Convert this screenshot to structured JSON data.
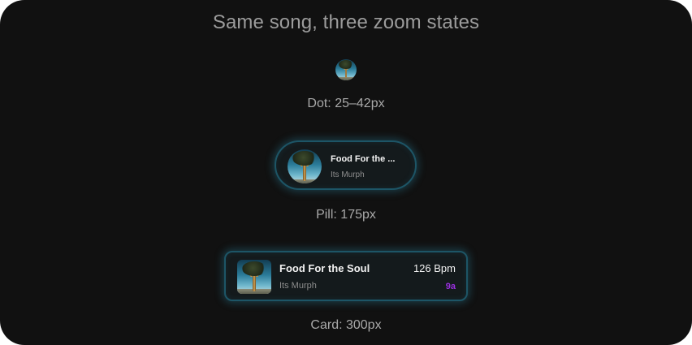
{
  "title": "Same song, three zoom states",
  "song": {
    "title": "Food For the Soul",
    "title_truncated": "Food For the ...",
    "artist": "Its Murph",
    "bpm": "126 Bpm",
    "key": "9a"
  },
  "captions": {
    "dot": "Dot: 25–42px",
    "pill": "Pill: 175px",
    "card": "Card: 300px"
  },
  "colors": {
    "background": "#111111",
    "glow": "#2e96b4",
    "key_accent": "#9a2fe0"
  },
  "icons": {
    "artwork": "album-artwork-tree"
  }
}
